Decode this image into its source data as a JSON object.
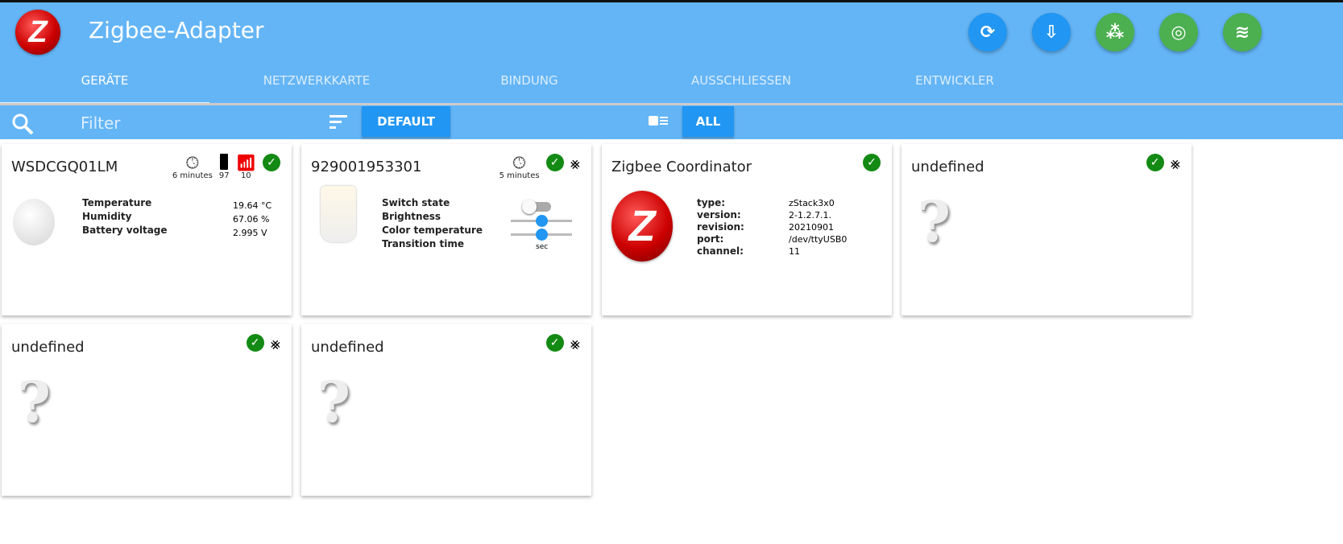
{
  "header": {
    "title": "Zigbee-Adapter",
    "logo_text": "Z",
    "actions": [
      {
        "name": "refresh",
        "glyph": "⟳",
        "color": "#2196f3"
      },
      {
        "name": "download-device",
        "glyph": "⇩",
        "color": "#2196f3"
      },
      {
        "name": "group",
        "glyph": "⁂",
        "color": "#4caf50"
      },
      {
        "name": "pairing",
        "glyph": "◎",
        "color": "#4caf50"
      },
      {
        "name": "network",
        "glyph": "≋",
        "color": "#4caf50"
      }
    ]
  },
  "tabs": [
    "GERÄTE",
    "NETZWERKKARTE",
    "BINDUNG",
    "AUSSCHLIESSEN",
    "ENTWICKLER"
  ],
  "toolbar": {
    "filter_placeholder": "Filter",
    "sort_label": "DEFAULT",
    "view_label": "ALL"
  },
  "cards": [
    {
      "name": "WSDCGQ01LM",
      "last_seen": "6 minutes",
      "battery": "97",
      "link_quality": "10",
      "props": [
        [
          "Temperature",
          "19.64 °C"
        ],
        [
          "Humidity",
          "67.06 %"
        ],
        [
          "Battery voltage",
          "2.995 V"
        ]
      ]
    },
    {
      "name": "929001953301",
      "last_seen": "5 minutes",
      "props": [
        "Switch state",
        "Brightness",
        "Color temperature",
        "Transition time"
      ],
      "unit": "sec",
      "switch_on": false,
      "brightness": 0.5,
      "color_temperature": 0.5
    },
    {
      "name": "Zigbee Coordinator",
      "props": [
        [
          "type:",
          "zStack3x0"
        ],
        [
          "version:",
          "2-1.2.7.1."
        ],
        [
          "revision:",
          "20210901"
        ],
        [
          "port:",
          "/dev/ttyUSB0"
        ],
        [
          "channel:",
          "11"
        ]
      ]
    },
    {
      "name": "undefined"
    },
    {
      "name": "undefined"
    },
    {
      "name": "undefined"
    }
  ],
  "colors": {
    "header": "#64b5f6",
    "accent": "#2196f3",
    "ok": "#138a13"
  }
}
